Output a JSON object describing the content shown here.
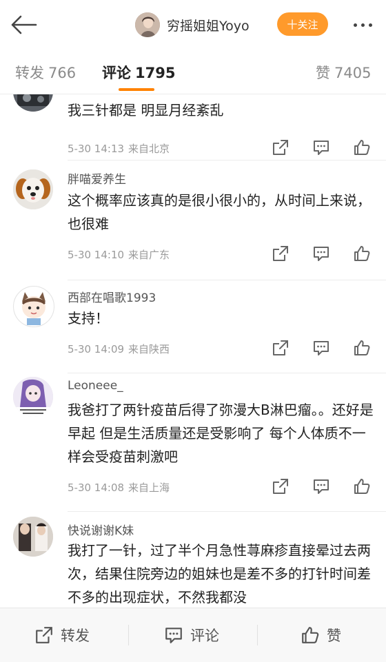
{
  "header": {
    "author_name": "穷摇姐姐Yoyo",
    "follow_label": "十关注"
  },
  "tabs": {
    "repost_label": "转发",
    "repost_count": "766",
    "comment_label": "评论",
    "comment_count": "1795",
    "like_label": "赞",
    "like_count": "7405"
  },
  "comments": [
    {
      "user": "",
      "text": "我三针都是  明显月经紊乱",
      "time": "5-30 14:13",
      "source": "来自北京"
    },
    {
      "user": "胖喵爱养生",
      "text": "这个概率应该真的是很小很小的，从时间上来说，也很难",
      "time": "5-30 14:10",
      "source": "来自广东"
    },
    {
      "user": "西部在唱歌1993",
      "text": "支持！",
      "time": "5-30 14:09",
      "source": "来自陕西"
    },
    {
      "user": "Leoneee_",
      "text": "我爸打了两针疫苗后得了弥漫大B淋巴瘤。。还好是早起 但是生活质量还是受影响了 每个人体质不一样会受疫苗刺激吧",
      "time": "5-30 14:08",
      "source": "来自上海"
    },
    {
      "user": "快说谢谢K妹",
      "text": "我打了一针，过了半个月急性荨麻疹直接晕过去两次，结果住院旁边的姐妹也是差不多的打针时间差不多的出现症状，不然我都没",
      "time": "",
      "source": ""
    }
  ],
  "bottom_bar": {
    "repost_label": "转发",
    "comment_label": "评论",
    "like_label": "赞"
  },
  "colors": {
    "accent": "#ff8200",
    "follow_bg": "#ff9a2b",
    "text_primary": "#222222",
    "text_secondary": "#9a9a9a"
  }
}
